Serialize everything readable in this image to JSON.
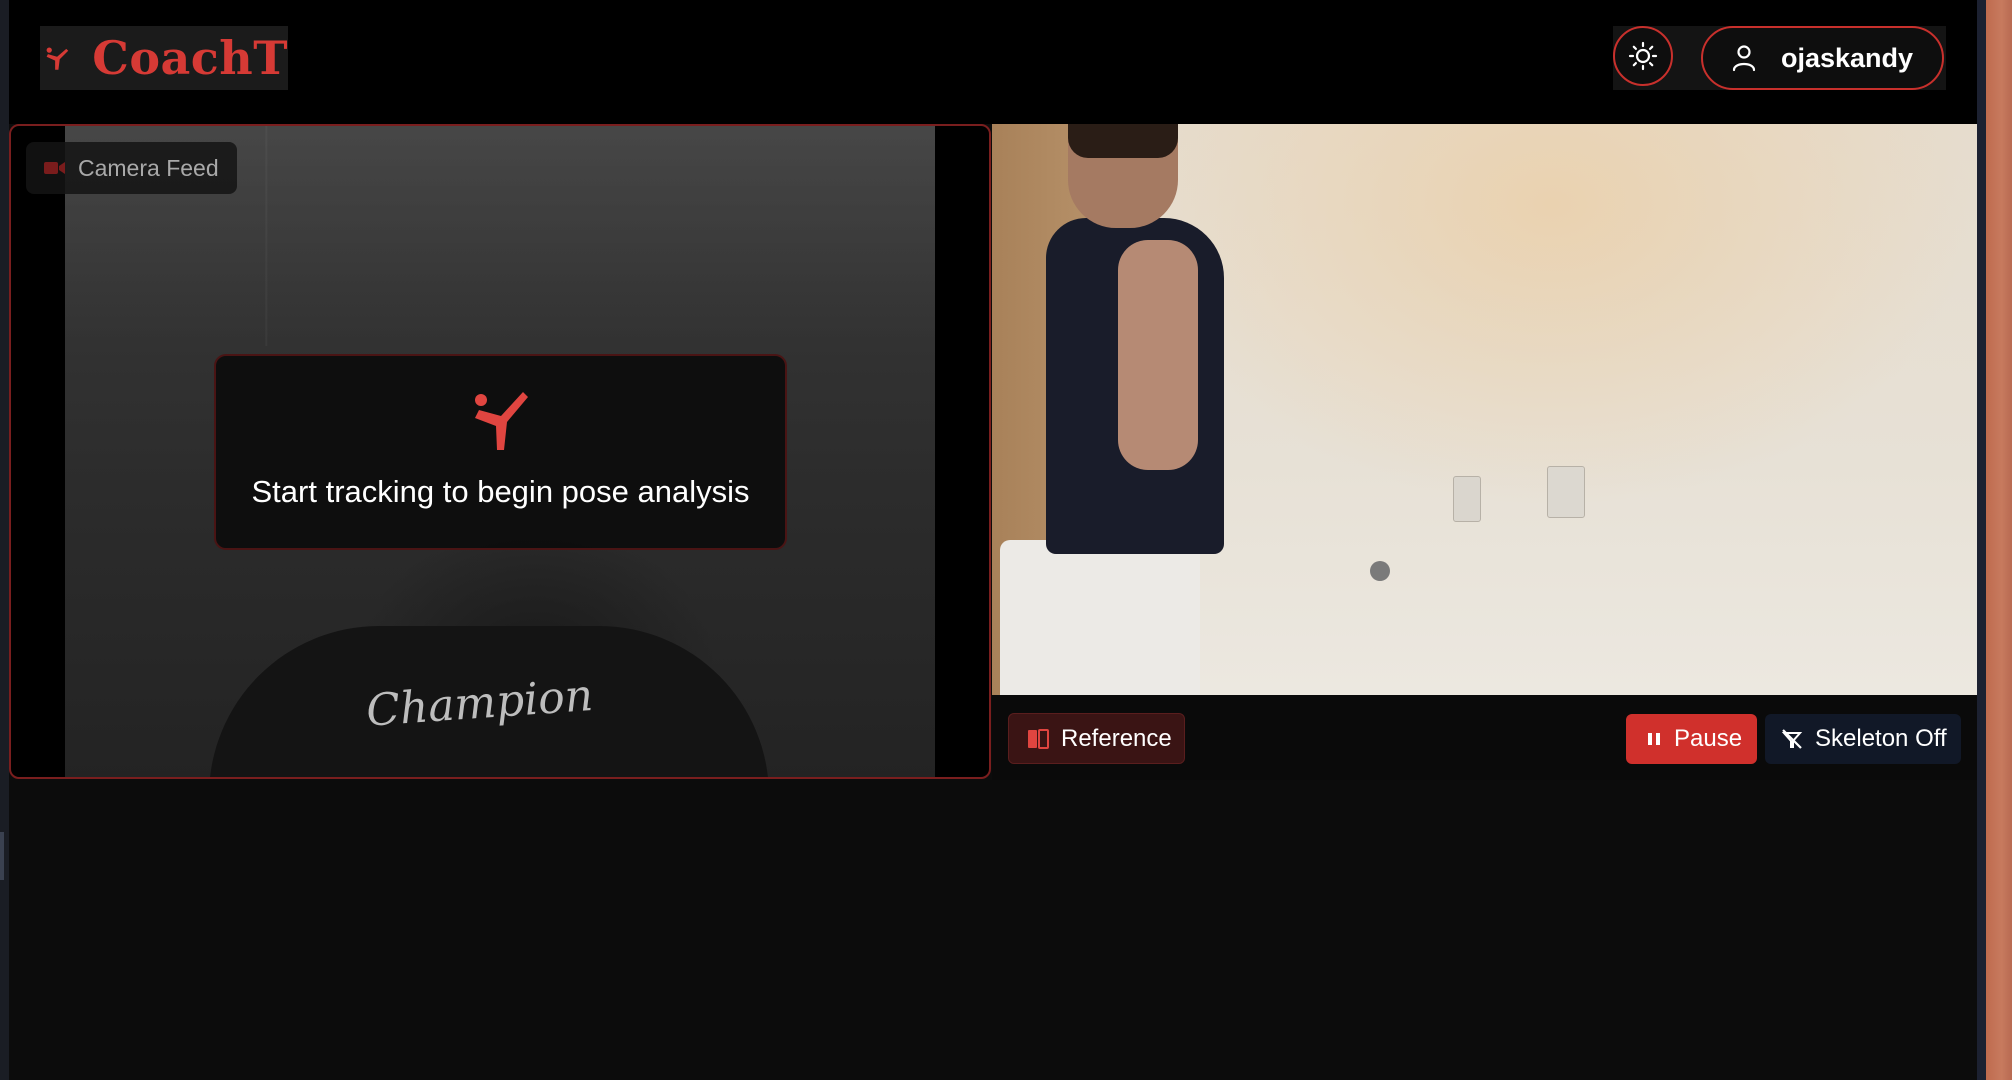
{
  "header": {
    "brand": "CoachT",
    "username": "ojaskandy",
    "theme_icon": "sun-icon",
    "user_icon": "user-icon"
  },
  "camera_panel": {
    "badge_label": "Camera Feed",
    "prompt_text": "Start tracking to begin pose analysis",
    "prompt_icon": "martial-arts-kick-icon"
  },
  "reference_panel": {
    "reference_label": "Reference",
    "pause_label": "Pause",
    "skeleton_label": "Skeleton Off"
  },
  "colors": {
    "accent": "#d0302c",
    "background": "#0c0c0c",
    "header_bg": "#000000"
  }
}
